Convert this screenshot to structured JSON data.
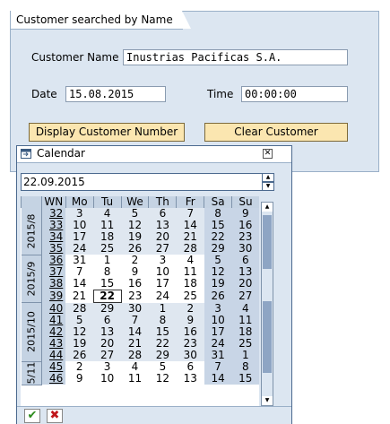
{
  "panel": {
    "title": "Customer searched by Name",
    "customer_name_label": "Customer Name",
    "customer_name_value": "Inustrias Pacificas S.A.",
    "date_label": "Date",
    "date_value": "15.08.2015",
    "time_label": "Time",
    "time_value": "00:00:00",
    "display_button": "Display Customer Number",
    "clear_button": "Clear Customer"
  },
  "calendar": {
    "title": "Calendar",
    "close_icon": "close-icon",
    "date_value": "22.09.2015",
    "headers": [
      "WN",
      "Mo",
      "Tu",
      "We",
      "Th",
      "Fr",
      "Sa",
      "Su"
    ],
    "months": [
      {
        "label": "2015/8",
        "weeks": [
          "32",
          "33",
          "34",
          "35"
        ]
      },
      {
        "label": "2015/9",
        "weeks": [
          "36",
          "37",
          "38",
          "39"
        ]
      },
      {
        "label": "2015/10",
        "weeks": [
          "40",
          "41",
          "42",
          "43",
          "44"
        ]
      },
      {
        "label": "5/11",
        "weeks": [
          "45",
          "46"
        ]
      }
    ],
    "rows": [
      [
        "3",
        "4",
        "5",
        "6",
        "7",
        "8",
        "9"
      ],
      [
        "10",
        "11",
        "12",
        "13",
        "14",
        "15",
        "16"
      ],
      [
        "17",
        "18",
        "19",
        "20",
        "21",
        "22",
        "23"
      ],
      [
        "24",
        "25",
        "26",
        "27",
        "28",
        "29",
        "30"
      ],
      [
        "31",
        "1",
        "2",
        "3",
        "4",
        "5",
        "6"
      ],
      [
        "7",
        "8",
        "9",
        "10",
        "11",
        "12",
        "13"
      ],
      [
        "14",
        "15",
        "16",
        "17",
        "18",
        "19",
        "20"
      ],
      [
        "21",
        "22",
        "23",
        "24",
        "25",
        "26",
        "27"
      ],
      [
        "28",
        "29",
        "30",
        "1",
        "2",
        "3",
        "4"
      ],
      [
        "5",
        "6",
        "7",
        "8",
        "9",
        "10",
        "11"
      ],
      [
        "12",
        "13",
        "14",
        "15",
        "16",
        "17",
        "18"
      ],
      [
        "19",
        "20",
        "21",
        "22",
        "23",
        "24",
        "25"
      ],
      [
        "26",
        "27",
        "28",
        "29",
        "30",
        "31",
        "1"
      ],
      [
        "2",
        "3",
        "4",
        "5",
        "6",
        "7",
        "8"
      ],
      [
        "9",
        "10",
        "11",
        "12",
        "13",
        "14",
        "15"
      ]
    ],
    "selected_day": "22",
    "confirm_icon": "check-icon",
    "cancel_icon": "cancel-icon"
  }
}
